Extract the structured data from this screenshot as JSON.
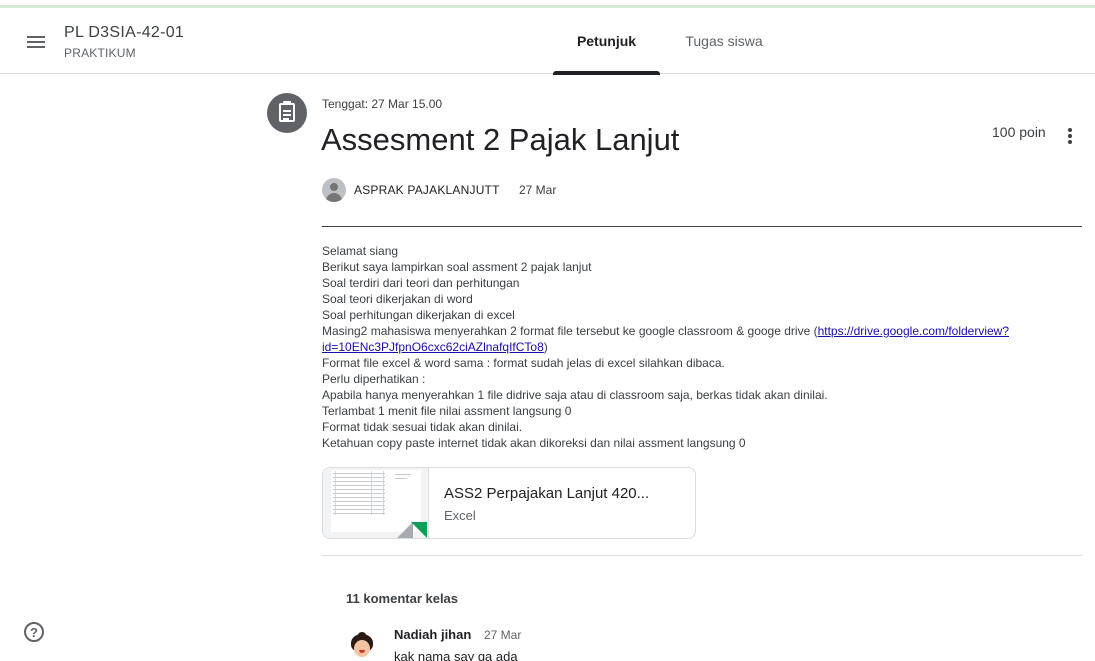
{
  "header": {
    "class_name": "PL D3SIA-42-01",
    "class_section": "PRAKTIKUM",
    "tabs": [
      {
        "label": "Petunjuk",
        "active": true
      },
      {
        "label": "Tugas siswa",
        "active": false
      }
    ]
  },
  "assignment": {
    "due": "Tenggat: 27 Mar 15.00",
    "title": "Assesment 2 Pajak Lanjut",
    "points": "100 poin",
    "author": "ASPRAK PAJAKLANJUTT",
    "posted_date": "27 Mar",
    "description": [
      "Selamat siang",
      "Berikut saya lampirkan soal assment 2 pajak lanjut",
      "Soal terdiri dari teori dan perhitungan",
      "Soal teori dikerjakan di word",
      "Soal perhitungan dikerjakan di excel"
    ],
    "description_link_prefix": "Masing2 mahasiswa menyerahkan 2 format file tersebut ke google classroom & googe drive (",
    "description_link_line1": "https://drive.google.com/folderview?",
    "description_link_line2": "id=10ENc3PJfpnO6cxc62ciAZlnafqIfCTo8",
    "description_link_suffix": ")",
    "description_after": [
      "Format file excel & word sama : format sudah jelas di excel silahkan dibaca.",
      "Perlu diperhatikan :",
      "Apabila hanya menyerahkan 1 file didrive saja atau di classroom saja, berkas tidak akan dinilai.",
      "Terlambat 1 menit file nilai assment langsung 0",
      "Format tidak sesuai tidak akan dinilai.",
      "Ketahuan copy paste internet tidak akan dikoreksi dan nilai assment langsung 0"
    ],
    "attachment": {
      "name": "ASS2 Perpajakan Lanjut 420...",
      "type": "Excel"
    }
  },
  "comments": {
    "count_label": "11 komentar kelas",
    "items": [
      {
        "author": "Nadiah jihan",
        "date": "27 Mar",
        "text": "kak nama say ga ada"
      }
    ]
  },
  "help": {
    "glyph": "?"
  },
  "colors": {
    "active_tab": "#202124",
    "excel_green": "#0f9d58",
    "icon_gray": "#5f6368"
  }
}
